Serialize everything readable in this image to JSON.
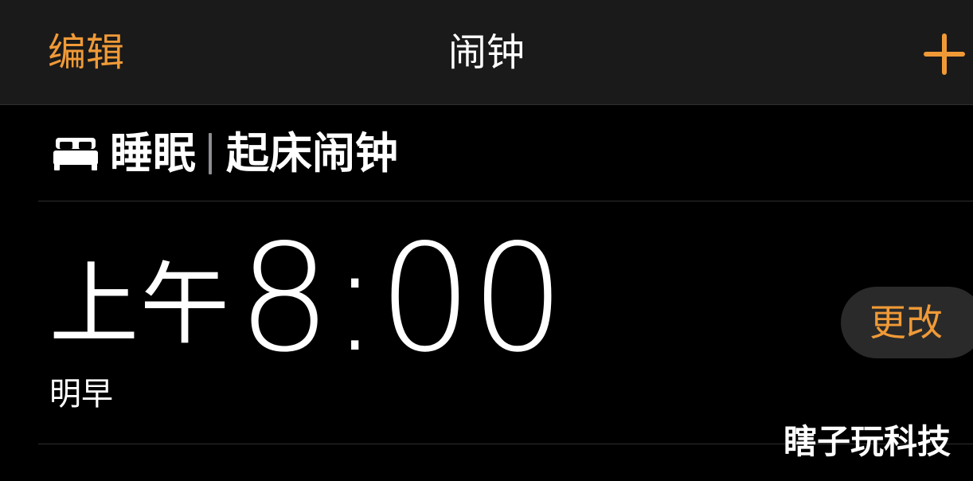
{
  "nav": {
    "edit_label": "编辑",
    "title": "闹钟",
    "add_icon": "plus-icon"
  },
  "sleep_section": {
    "icon": "bed-icon",
    "title": "睡眠",
    "subtitle": "起床闹钟"
  },
  "alarm": {
    "period": "上午",
    "time": "8:00",
    "label": "明早",
    "change_label": "更改"
  },
  "watermark": "瞎子玩科技",
  "colors": {
    "accent": "#f09a37",
    "background": "#000000",
    "nav_background": "#1a1a1a",
    "button_background": "#2a2a2a",
    "separator": "#8e8e93"
  }
}
